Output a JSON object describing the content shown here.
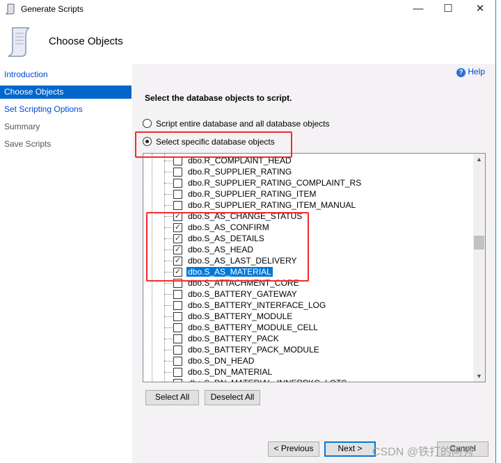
{
  "window": {
    "title": "Generate Scripts",
    "minimize": "—",
    "maximize": "☐",
    "close": "✕"
  },
  "header": {
    "title": "Choose Objects"
  },
  "sidebar": {
    "items": [
      {
        "label": "Introduction",
        "state": "link"
      },
      {
        "label": "Choose Objects",
        "state": "active"
      },
      {
        "label": "Set Scripting Options",
        "state": "link"
      },
      {
        "label": "Summary",
        "state": "disabled"
      },
      {
        "label": "Save Scripts",
        "state": "disabled"
      }
    ]
  },
  "help": {
    "label": "Help"
  },
  "main": {
    "instruction": "Select the database objects to script.",
    "option_all": "Script entire database and all database objects",
    "option_specific": "Select specific database objects",
    "selected_option": "specific",
    "objects": [
      {
        "name": "dbo.R_COMPLAINT_HEAD",
        "checked": false
      },
      {
        "name": "dbo.R_SUPPLIER_RATING",
        "checked": false
      },
      {
        "name": "dbo.R_SUPPLIER_RATING_COMPLAINT_RS",
        "checked": false
      },
      {
        "name": "dbo.R_SUPPLIER_RATING_ITEM",
        "checked": false
      },
      {
        "name": "dbo.R_SUPPLIER_RATING_ITEM_MANUAL",
        "checked": false
      },
      {
        "name": "dbo.S_AS_CHANGE_STATUS",
        "checked": true
      },
      {
        "name": "dbo.S_AS_CONFIRM",
        "checked": true
      },
      {
        "name": "dbo.S_AS_DETAILS",
        "checked": true
      },
      {
        "name": "dbo.S_AS_HEAD",
        "checked": true
      },
      {
        "name": "dbo.S_AS_LAST_DELIVERY",
        "checked": true
      },
      {
        "name": "dbo.S_AS_MATERIAL",
        "checked": true,
        "selected": true
      },
      {
        "name": "dbo.S_ATTACHMENT_CORE",
        "checked": false
      },
      {
        "name": "dbo.S_BATTERY_GATEWAY",
        "checked": false
      },
      {
        "name": "dbo.S_BATTERY_INTERFACE_LOG",
        "checked": false
      },
      {
        "name": "dbo.S_BATTERY_MODULE",
        "checked": false
      },
      {
        "name": "dbo.S_BATTERY_MODULE_CELL",
        "checked": false
      },
      {
        "name": "dbo.S_BATTERY_PACK",
        "checked": false
      },
      {
        "name": "dbo.S_BATTERY_PACK_MODULE",
        "checked": false
      },
      {
        "name": "dbo.S_DN_HEAD",
        "checked": false
      },
      {
        "name": "dbo.S_DN_MATERIAL",
        "checked": false
      },
      {
        "name": "dbo.S_DN_MATERIAL_INNERPKG_LOTS",
        "checked": false
      }
    ],
    "select_all": "Select All",
    "deselect_all": "Deselect All"
  },
  "footer": {
    "previous": "< Previous",
    "next": "Next >",
    "cancel": "Cancel"
  },
  "watermark": "CSDN @铁打的阿秀",
  "colors": {
    "accent": "#0066cc",
    "annotation": "#f42a2a",
    "selection": "#0078d7"
  }
}
